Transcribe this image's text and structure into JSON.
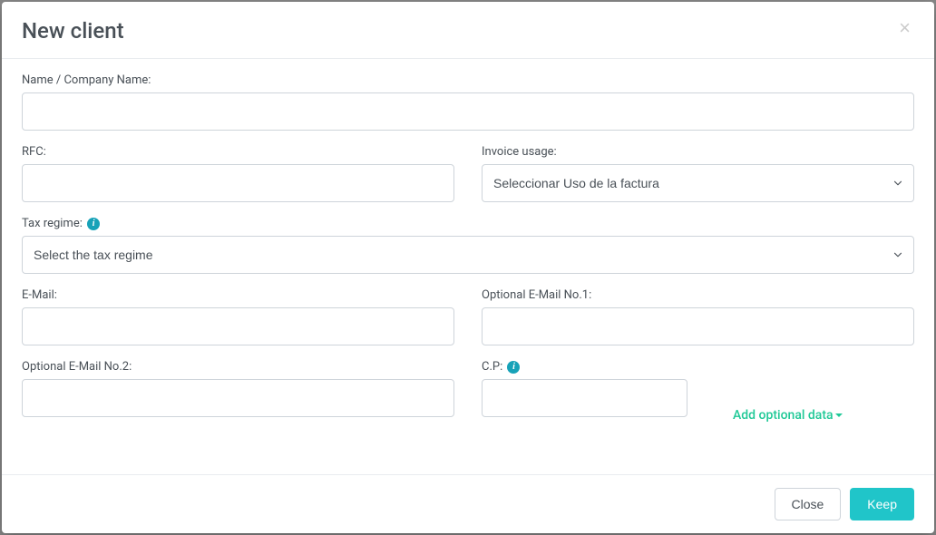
{
  "modal": {
    "title": "New client",
    "close_icon": "×"
  },
  "form": {
    "name_label": "Name / Company Name:",
    "name_value": "",
    "rfc_label": "RFC:",
    "rfc_value": "",
    "invoice_usage_label": "Invoice usage:",
    "invoice_usage_selected": "Seleccionar Uso de la factura",
    "tax_regime_label": "Tax regime:",
    "tax_regime_selected": "Select the tax regime",
    "email_label": "E-Mail:",
    "email_value": "",
    "optional_email1_label": "Optional E-Mail No.1:",
    "optional_email1_value": "",
    "optional_email2_label": "Optional E-Mail No.2:",
    "optional_email2_value": "",
    "cp_label": "C.P:",
    "cp_value": "",
    "add_optional_link": "Add optional data"
  },
  "footer": {
    "close_label": "Close",
    "keep_label": "Keep"
  }
}
